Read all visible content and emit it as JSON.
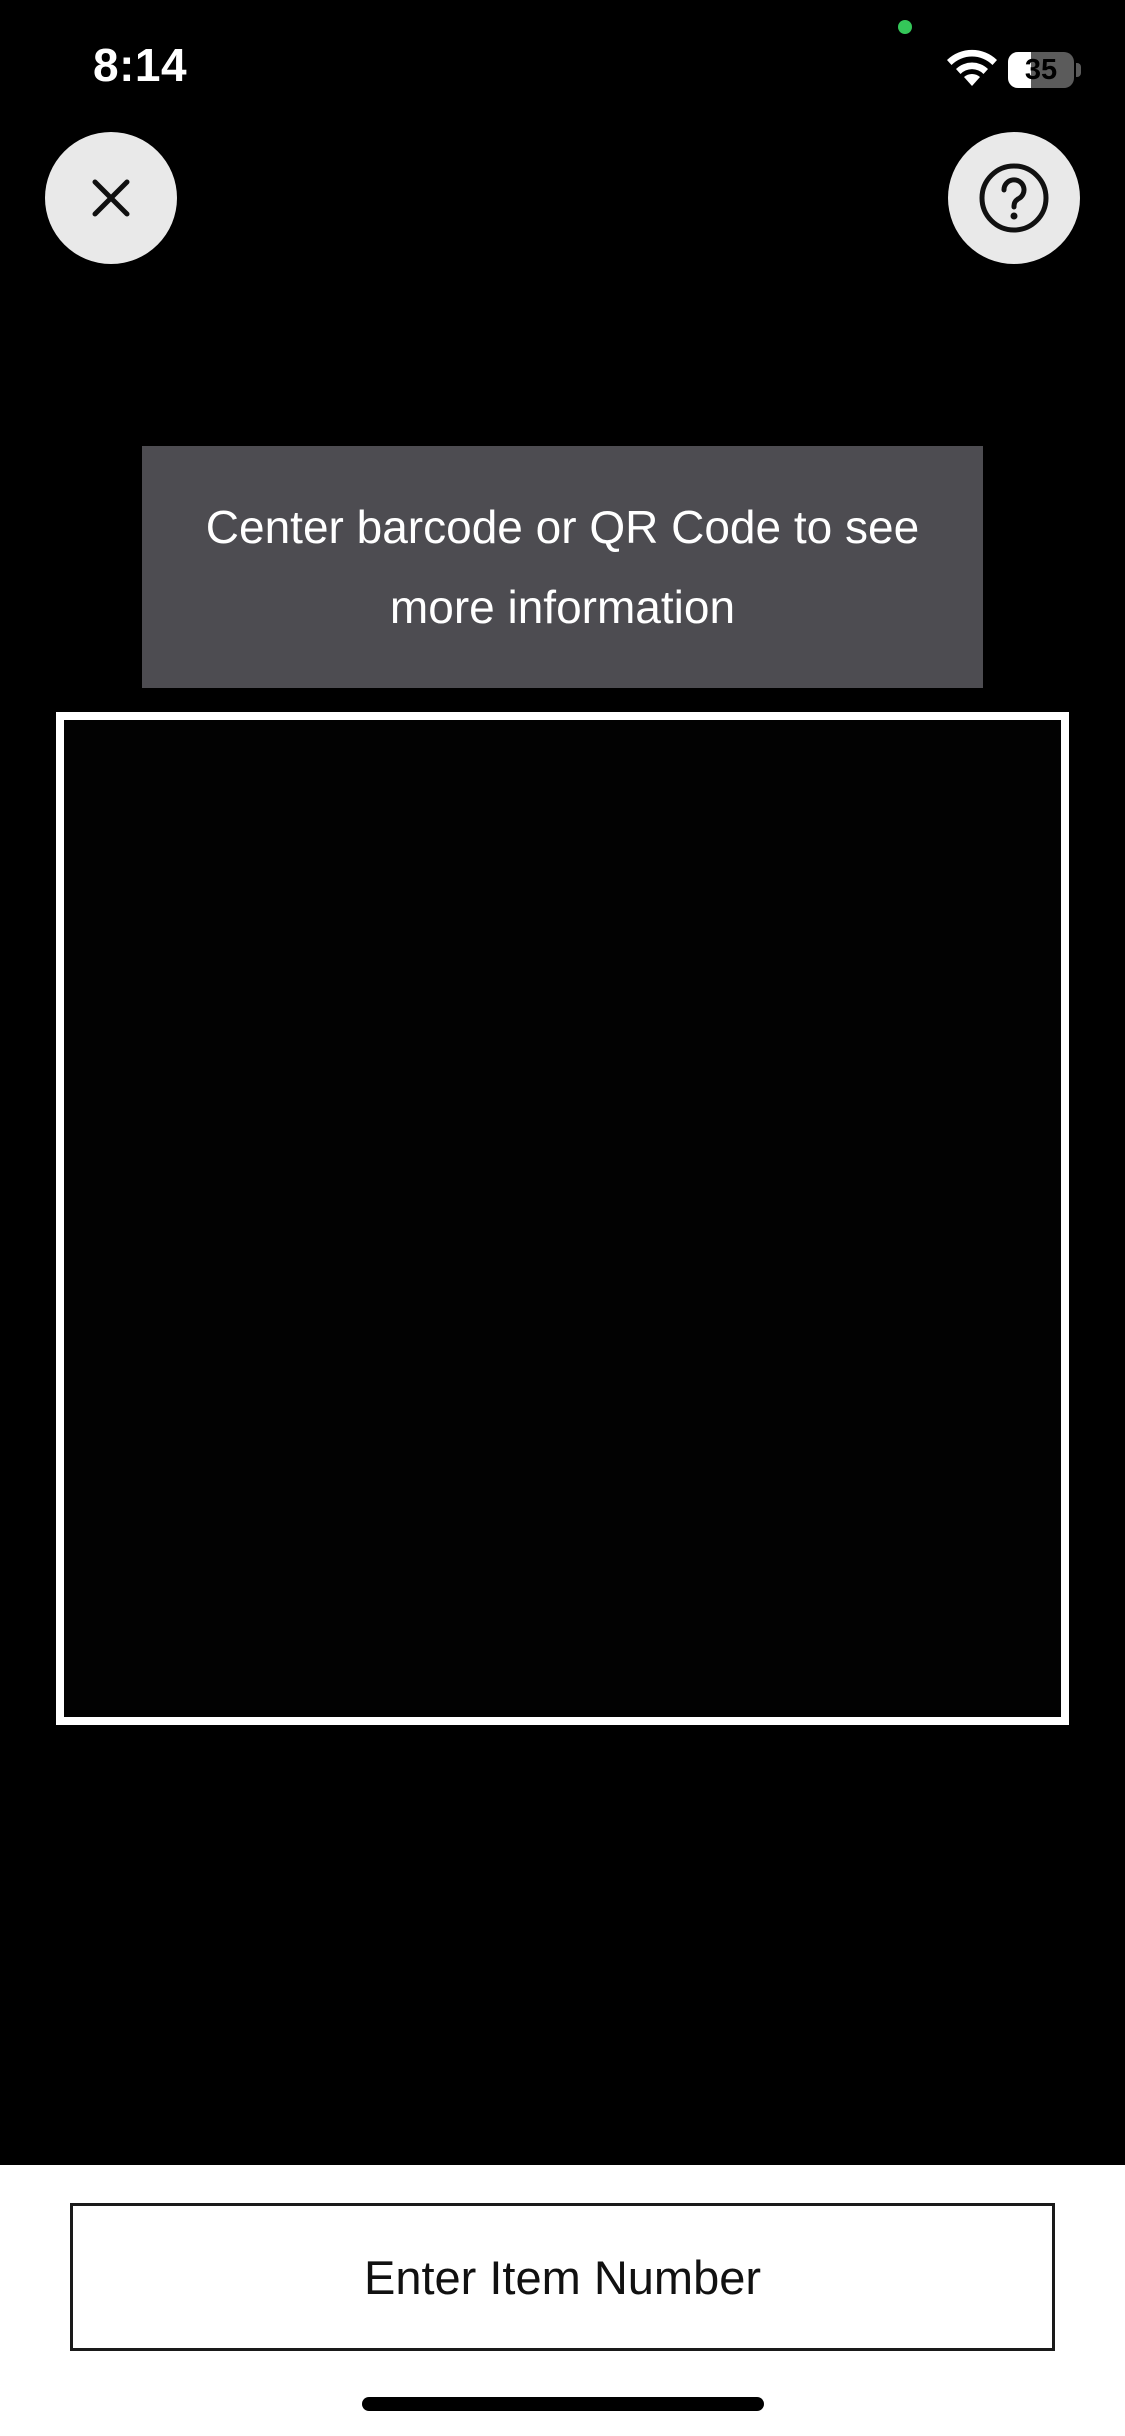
{
  "status_bar": {
    "time": "8:14",
    "battery_level": "35",
    "battery_fraction": 0.35,
    "privacy_dot_color": "#34c759",
    "wifi_icon": "wifi-icon"
  },
  "header": {
    "close_icon": "close-icon",
    "help_icon": "question-circle-icon"
  },
  "scanner": {
    "instruction": "Center barcode or QR Code to see more information"
  },
  "footer": {
    "enter_item_label": "Enter Item Number"
  },
  "colors": {
    "background": "#000000",
    "banner": "#4d4c51",
    "button_bg": "#e9e9e9",
    "frame": "#ffffff"
  }
}
